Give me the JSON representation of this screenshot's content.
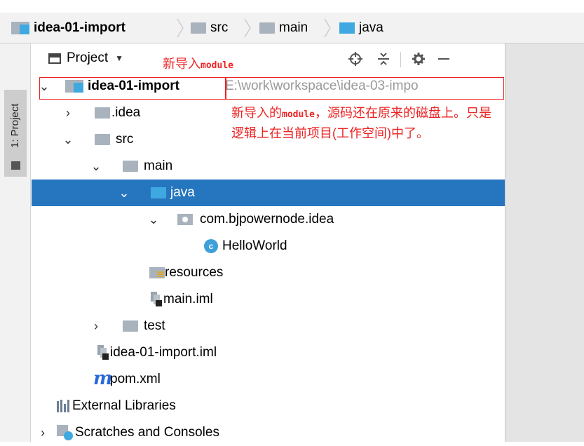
{
  "breadcrumb": {
    "items": [
      {
        "label": "idea-01-import",
        "icon": "module-folder-icon"
      },
      {
        "label": "src",
        "icon": "folder-icon"
      },
      {
        "label": "main",
        "icon": "folder-icon"
      },
      {
        "label": "java",
        "icon": "source-folder-icon"
      }
    ]
  },
  "side_tab": {
    "label": "1: Project"
  },
  "toolwindow": {
    "view_label": "Project",
    "icons": [
      "locate-icon",
      "collapse-all-icon",
      "gear-icon",
      "hide-icon"
    ]
  },
  "tree": {
    "root": {
      "label": "idea-01-import",
      "path": "E:\\work\\workspace\\idea-03-impo"
    },
    "idea": "idea",
    "src": "src",
    "main": "main",
    "java": "java",
    "package": "com.bjpowernode.idea",
    "class": "HelloWorld",
    "class_badge": "c",
    "resources": "resources",
    "main_iml": "main.iml",
    "test": "test",
    "module_iml": "idea-01-import.iml",
    "pom": "pom.xml",
    "maven_glyph": "m",
    "external_libraries": "External Libraries",
    "scratches": "Scratches and Consoles"
  },
  "annotations": {
    "title_prefix": "新导入",
    "title_code": "module",
    "note_line1_prefix": "新导入的",
    "note_line1_code": "module",
    "note_line1_suffix": "，源码还在原来的磁盘上。只是",
    "note_line2": "逻辑上在当前项目(工作空间)中了。"
  },
  "colors": {
    "selection": "#2675bf",
    "annotation": "#ee2222",
    "source_folder": "#40a8e0",
    "folder": "#a9b3bd"
  }
}
